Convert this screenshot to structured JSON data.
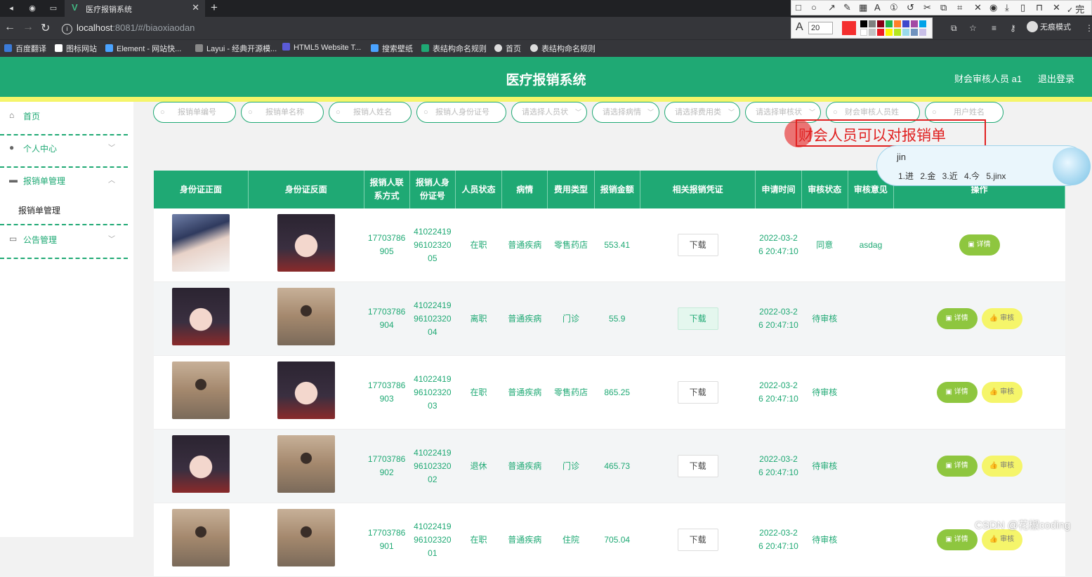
{
  "browser": {
    "tab_title": "医疗报销系统",
    "url_host": "localhost",
    "url_rest": ":8081/#/biaoxiaodan",
    "bookmarks": [
      "百度翻译",
      "图标网站",
      "Element - 网站快...",
      "Layui - 经典开源模...",
      "HTML5 Website T...",
      "搜索壁纸",
      "表结构命名规则",
      "首页",
      "表结构命名规则"
    ],
    "incognito_label": "无痕模式"
  },
  "snip_tool": {
    "font_size": "20",
    "done_label": "完成",
    "accent": "#f42e2e"
  },
  "header": {
    "title": "医疗报销系统",
    "user": "财会审核人员 a1",
    "logout": "退出登录",
    "color": "#1fa974",
    "strip_color": "#f5f56a"
  },
  "sidebar": {
    "items": [
      {
        "label": "首页",
        "icon": "home-icon"
      },
      {
        "label": "个人中心",
        "icon": "user-icon"
      },
      {
        "label": "报销单管理",
        "icon": "card-icon"
      },
      {
        "label": "公告管理",
        "icon": "notice-icon"
      }
    ],
    "sub_item": "报销单管理"
  },
  "search": {
    "placeholders": [
      "报销单编号",
      "报销单名称",
      "报销人姓名",
      "报销人身份证号",
      "请选择人员状",
      "请选择病情",
      "请选择费用类",
      "请选择审核状",
      "财会审核人员姓",
      "用户姓名"
    ]
  },
  "annotation": {
    "text": "财会人员可以对报销单",
    "ime_input": "jin",
    "ime_candidates": "1.进 2.金 3.近 4.今 5.jinx"
  },
  "table": {
    "headers": [
      "身份证正面",
      "身份证反面",
      "报销人联系方式",
      "报销人身份证号",
      "人员状态",
      "病情",
      "费用类型",
      "报销金额",
      "相关报销凭证",
      "申请时间",
      "审核状态",
      "审核意见",
      "操作"
    ],
    "download_label": "下载",
    "detail_label": "详情",
    "review_label": "审核",
    "rows": [
      {
        "photo_front": "boy-photo",
        "photo_back": "girl-photo",
        "phone": "17703786905",
        "id_no": "410224199610232005",
        "status": "在职",
        "illness": "普通疾病",
        "fee_type": "零售药店",
        "amount": "553.41",
        "time": "2022-03-26 20:47:10",
        "audit": "同意",
        "opinion": "asdag",
        "show_review": false
      },
      {
        "photo_front": "girl-photo",
        "photo_back": "selfie-photo",
        "phone": "17703786904",
        "id_no": "410224199610232004",
        "status": "离职",
        "illness": "普通疾病",
        "fee_type": "门诊",
        "amount": "55.9",
        "time": "2022-03-26 20:47:10",
        "audit": "待审核",
        "opinion": "",
        "show_review": true
      },
      {
        "photo_front": "selfie-photo",
        "photo_back": "girl-photo",
        "phone": "17703786903",
        "id_no": "410224199610232003",
        "status": "在职",
        "illness": "普通疾病",
        "fee_type": "零售药店",
        "amount": "865.25",
        "time": "2022-03-26 20:47:10",
        "audit": "待审核",
        "opinion": "",
        "show_review": true
      },
      {
        "photo_front": "girl-photo",
        "photo_back": "selfie-photo",
        "phone": "17703786902",
        "id_no": "410224199610232002",
        "status": "退休",
        "illness": "普通疾病",
        "fee_type": "门诊",
        "amount": "465.73",
        "time": "2022-03-26 20:47:10",
        "audit": "待审核",
        "opinion": "",
        "show_review": true
      },
      {
        "photo_front": "selfie-photo",
        "photo_back": "selfie-photo",
        "phone": "17703786901",
        "id_no": "410224199610232001",
        "status": "在职",
        "illness": "普通疾病",
        "fee_type": "住院",
        "amount": "705.04",
        "time": "2022-03-26 20:47:10",
        "audit": "待审核",
        "opinion": "",
        "show_review": true
      }
    ]
  },
  "watermark": "CSDN @花椒coding"
}
